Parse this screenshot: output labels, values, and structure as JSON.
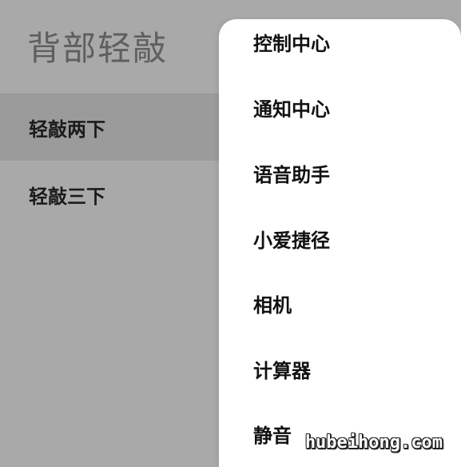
{
  "page": {
    "title": "背部轻敲"
  },
  "settings": {
    "items": [
      {
        "label": "轻敲两下"
      },
      {
        "label": "轻敲三下"
      }
    ]
  },
  "menu": {
    "items": [
      {
        "label": "控制中心"
      },
      {
        "label": "通知中心"
      },
      {
        "label": "语音助手"
      },
      {
        "label": "小爱捷径"
      },
      {
        "label": "相机"
      },
      {
        "label": "计算器"
      },
      {
        "label": "静音"
      }
    ]
  },
  "watermark": {
    "text": "hubeihong.com"
  },
  "colors": {
    "background": "#a9a9a9",
    "selected_row": "#9b9b9b",
    "menu_background": "#ffffff"
  }
}
